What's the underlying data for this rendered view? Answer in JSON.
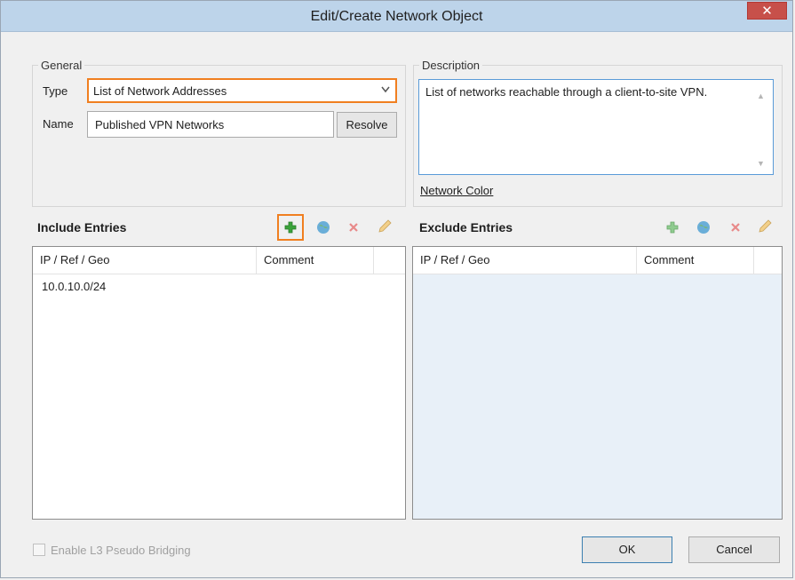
{
  "window": {
    "title": "Edit/Create Network Object",
    "close_glyph": "✕"
  },
  "general": {
    "group_label": "General",
    "type_label": "Type",
    "type_value": "List of Network Addresses",
    "name_label": "Name",
    "name_value": "Published VPN Networks",
    "resolve_label": "Resolve"
  },
  "description": {
    "group_label": "Description",
    "text": "List of networks reachable through a client-to-site VPN.",
    "network_color_link": "Network Color"
  },
  "include": {
    "title": "Include Entries",
    "columns": [
      "IP / Ref / Geo",
      "Comment"
    ],
    "rows": [
      "10.0.10.0/24"
    ],
    "icons": [
      "add-icon",
      "globe-icon",
      "delete-icon",
      "edit-icon"
    ]
  },
  "exclude": {
    "title": "Exclude Entries",
    "columns": [
      "IP / Ref / Geo",
      "Comment"
    ],
    "rows": [],
    "icons": [
      "add-icon",
      "globe-icon",
      "delete-icon",
      "edit-icon"
    ]
  },
  "footer": {
    "checkbox_label": "Enable L3 Pseudo Bridging",
    "ok_label": "OK",
    "cancel_label": "Cancel"
  },
  "colors": {
    "accent_highlight": "#f07f20",
    "titlebar": "#bdd4ea",
    "close_button": "#c7504a",
    "exclude_grid_bg": "#e8f0f8",
    "add_green": "#3aa33a"
  }
}
